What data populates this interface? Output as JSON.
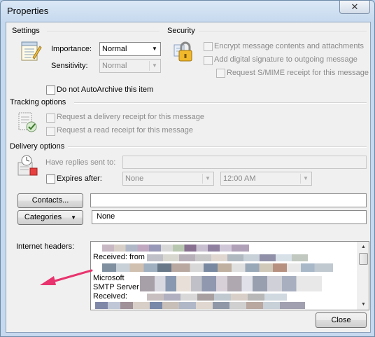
{
  "window": {
    "title": "Properties",
    "close_glyph": "✕"
  },
  "settings": {
    "title": "Settings",
    "importance_label": "Importance:",
    "importance_value": "Normal",
    "sensitivity_label": "Sensitivity:",
    "sensitivity_value": "Normal"
  },
  "security": {
    "title": "Security",
    "encrypt_label": "Encrypt message contents and attachments",
    "signature_label": "Add digital signature to outgoing message",
    "smime_label": "Request S/MIME receipt for this message"
  },
  "autoarchive_label": "Do not AutoArchive this item",
  "tracking": {
    "title": "Tracking options",
    "delivery_receipt_label": "Request a delivery receipt for this message",
    "read_receipt_label": "Request a read receipt for this message"
  },
  "delivery": {
    "title": "Delivery options",
    "replies_label": "Have replies sent to:",
    "replies_value": "",
    "expires_label": "Expires after:",
    "expires_date": "None",
    "expires_time": "12:00 AM"
  },
  "contacts_button": "Contacts...",
  "contacts_value": "",
  "categories_button": "Categories",
  "categories_value": "None",
  "headers": {
    "label": "Internet headers:",
    "lines": [
      "Received: from",
      "Microsoft",
      " SMTP Server",
      "Received:"
    ]
  },
  "close_button": "Close",
  "colors": {
    "annotation_arrow": "#e8336e",
    "window_frame": "#c6d9ee",
    "dialog_bg": "#f0f0f0"
  },
  "icons": [
    "settings-notepad-icon",
    "security-padlock-icon",
    "tracking-receipt-icon",
    "delivery-stopwatch-icon",
    "annotation-arrow-icon"
  ]
}
